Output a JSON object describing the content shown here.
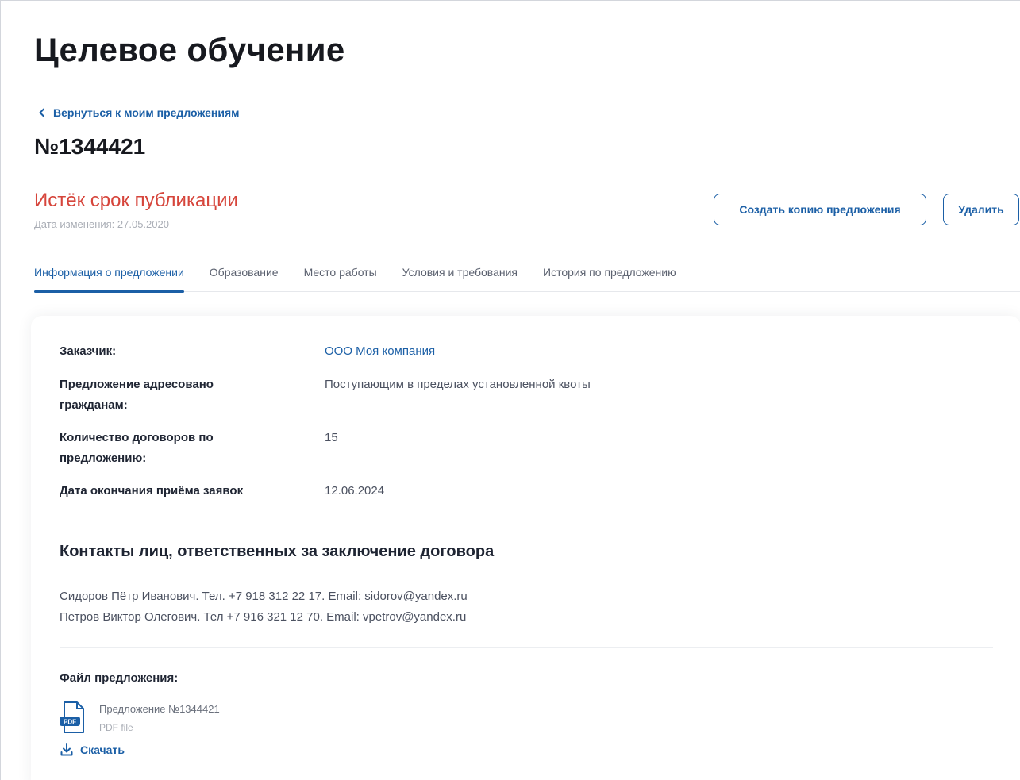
{
  "page": {
    "title": "Целевое обучение",
    "back_link": "Вернуться к моим предложениям",
    "offer_number": "№1344421",
    "status": "Истёк срок публикации",
    "change_date": "Дата изменения: 27.05.2020"
  },
  "actions": {
    "copy_label": "Создать копию предложения",
    "delete_label": "Удалить"
  },
  "tabs": [
    {
      "label": "Информация о предложении",
      "active": true
    },
    {
      "label": "Образование",
      "active": false
    },
    {
      "label": "Место работы",
      "active": false
    },
    {
      "label": "Условия и требования",
      "active": false
    },
    {
      "label": "История по предложению",
      "active": false
    }
  ],
  "info": {
    "customer_label": "Заказчик:",
    "customer_value": "ООО Моя компания",
    "addressed_label": "Предложение адресовано гражданам:",
    "addressed_value": "Поступающим в пределах установленной квоты",
    "contracts_label": "Количество договоров по предложению:",
    "contracts_value": "15",
    "deadline_label": "Дата окончания приёма заявок",
    "deadline_value": "12.06.2024"
  },
  "contacts": {
    "title": "Контакты лиц, ответственных за заключение договора",
    "lines": [
      "Сидоров Пётр Иванович. Тел. +7 918 312 22 17. Email: sidorov@yandex.ru",
      "Петров Виктор Олегович. Тел +7 916 321 12 70. Email: vpetrov@yandex.ru"
    ]
  },
  "file": {
    "label": "Файл предложения:",
    "name": "Предложение №1344421",
    "type": "PDF file",
    "icon_text": "PDF",
    "download_label": "Скачать"
  },
  "colors": {
    "accent": "#1b5fa6",
    "status_expired": "#d6453b"
  },
  "icons": {
    "back": "chevron-left-icon",
    "file": "pdf-file-icon",
    "download": "download-icon"
  }
}
